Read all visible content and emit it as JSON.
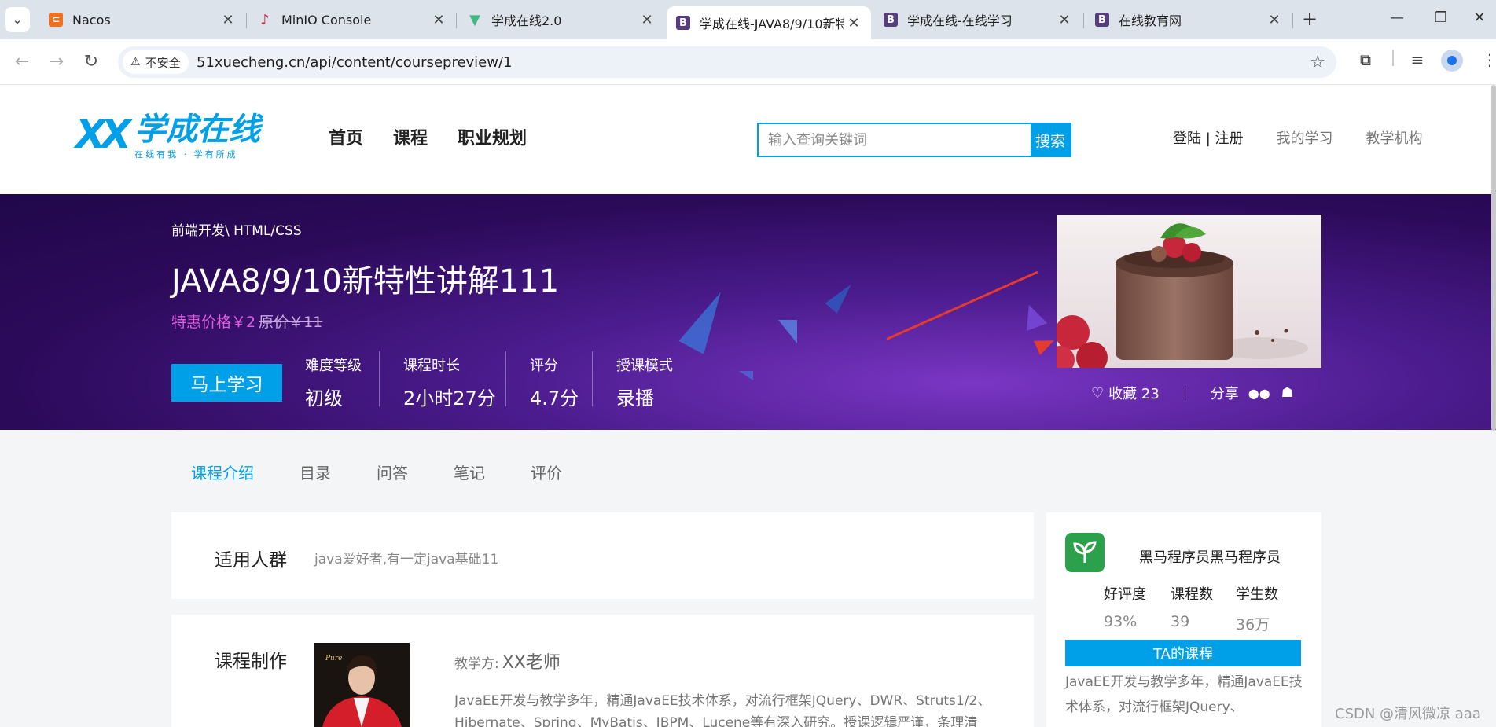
{
  "browser": {
    "tabs": [
      {
        "title": "Nacos",
        "favicon": "nacos-icon",
        "color": "#f07020"
      },
      {
        "title": "MinIO Console",
        "favicon": "minio-icon",
        "color": "#c72c48"
      },
      {
        "title": "学成在线2.0",
        "favicon": "vue-icon",
        "color": "#41b883"
      },
      {
        "title": "学成在线-JAVA8/9/10新特",
        "favicon": "bootstrap-icon",
        "color": "#563d7c"
      },
      {
        "title": "学成在线-在线学习",
        "favicon": "bootstrap-icon",
        "color": "#563d7c"
      },
      {
        "title": "在线教育网",
        "favicon": "bootstrap-icon",
        "color": "#563d7c"
      }
    ],
    "security_label": "不安全",
    "url": "51xuecheng.cn/api/content/coursepreview/1"
  },
  "header": {
    "logo_name": "学成在线",
    "logo_slogan": "在线有我 · 学有所成",
    "nav": [
      "首页",
      "课程",
      "职业规划"
    ],
    "search_placeholder": "输入查询关键词",
    "search_button": "搜索",
    "login": "登陆 | 注册",
    "my_learning": "我的学习",
    "institution": "教学机构"
  },
  "course": {
    "breadcrumb": "前端开发\\ HTML/CSS",
    "title": "JAVA8/9/10新特性讲解111",
    "price_label": "特惠价格￥2",
    "original_price": "原价￥11",
    "study_button": "马上学习",
    "stats": [
      {
        "label": "难度等级",
        "value": "初级"
      },
      {
        "label": "课程时长",
        "value": "2小时27分"
      },
      {
        "label": "评分",
        "value": "4.7分"
      },
      {
        "label": "授课模式",
        "value": "录播"
      }
    ],
    "favorite": "收藏 23",
    "share": "分享"
  },
  "tabs": [
    "课程介绍",
    "目录",
    "问答",
    "笔记",
    "评价"
  ],
  "content": {
    "audience_heading": "适用人群",
    "audience_text": "java爱好者,有一定java基础11",
    "production_heading": "课程制作",
    "teacher_label": "教学方:",
    "teacher_name": "XX老师",
    "teacher_desc": "JavaEE开发与教学多年，精通JavaEE技术体系，对流行框架JQuery、DWR、Struts1/2、Hibernate、Spring、MyBatis、JBPM、Lucene等有深入研究。授课逻辑严谨，条理清晰，"
  },
  "side": {
    "org_name": "黑马程序员黑马程序员",
    "stats": [
      {
        "label": "好评度",
        "value": "93%"
      },
      {
        "label": "课程数",
        "value": "39"
      },
      {
        "label": "学生数",
        "value": "36万"
      }
    ],
    "ta_courses": "TA的课程",
    "desc": "JavaEE开发与教学多年，精通JavaEE技术体系，对流行框架JQuery、"
  },
  "watermark": "CSDN @清风微凉 aaa"
}
